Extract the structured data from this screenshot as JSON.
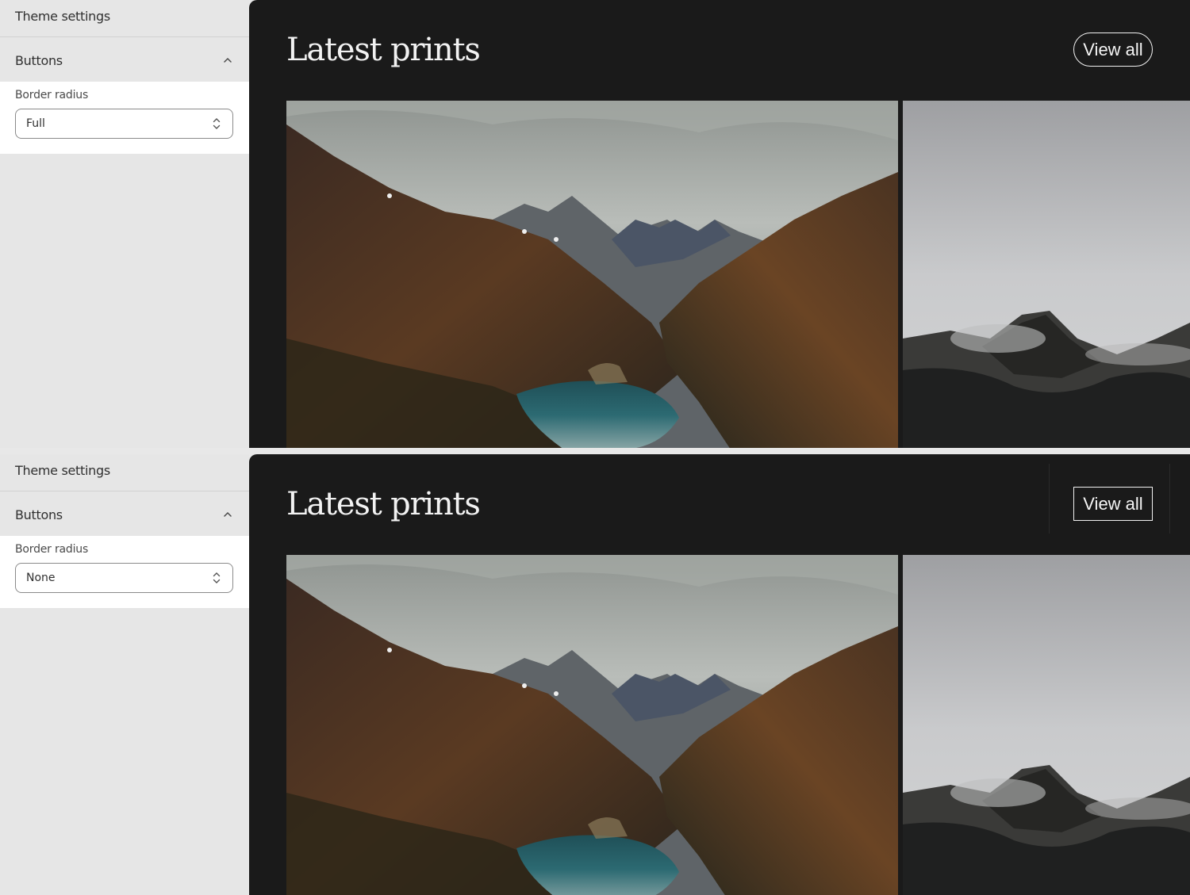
{
  "panels": [
    {
      "sidebar": {
        "title": "Theme settings",
        "section": "Buttons",
        "field_label": "Border radius",
        "select_value": "Full"
      },
      "preview": {
        "heading": "Latest prints",
        "button_label": "View all",
        "button_style": "rounded"
      }
    },
    {
      "sidebar": {
        "title": "Theme settings",
        "section": "Buttons",
        "field_label": "Border radius",
        "select_value": "None"
      },
      "preview": {
        "heading": "Latest prints",
        "button_label": "View all",
        "button_style": "square"
      }
    }
  ],
  "colors": {
    "sidebar_bg": "#e6e6e6",
    "preview_bg": "#1a1a1a",
    "text_light": "#f2f2f2"
  },
  "icons": [
    "chevron-up-icon",
    "select-arrows-icon"
  ]
}
